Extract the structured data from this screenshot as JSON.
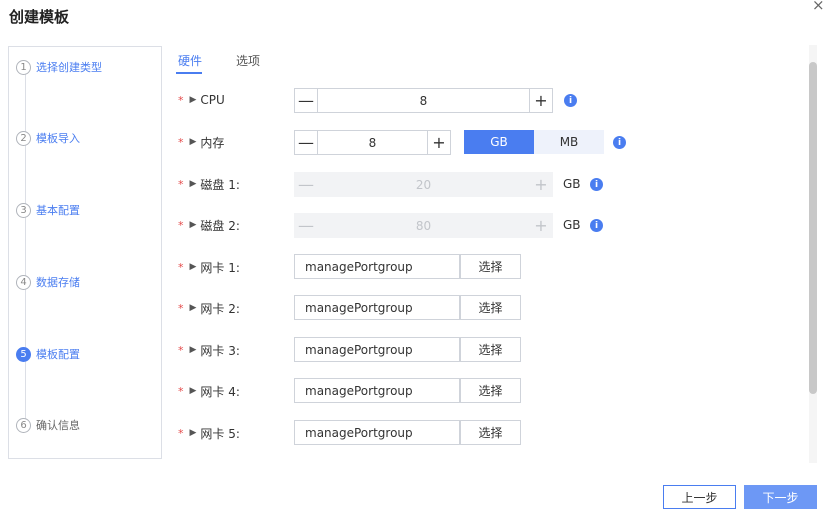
{
  "dialog": {
    "title": "创建模板",
    "close_glyph": "×"
  },
  "steps": [
    {
      "num": "1",
      "label": "选择创建类型"
    },
    {
      "num": "2",
      "label": "模板导入"
    },
    {
      "num": "3",
      "label": "基本配置"
    },
    {
      "num": "4",
      "label": "数据存储"
    },
    {
      "num": "5",
      "label": "模板配置"
    },
    {
      "num": "6",
      "label": "确认信息"
    }
  ],
  "tabs": [
    {
      "label": "硬件"
    },
    {
      "label": "选项"
    }
  ],
  "hardware": {
    "cpu": {
      "label": "CPU",
      "value": "8"
    },
    "memory": {
      "label": "内存",
      "value": "8",
      "units": [
        "GB",
        "MB"
      ],
      "selected_unit": "GB"
    },
    "disk1": {
      "label": "磁盘 1:",
      "value": "20",
      "unit": "GB"
    },
    "disk2": {
      "label": "磁盘 2:",
      "value": "80",
      "unit": "GB"
    },
    "nics": [
      {
        "label": "网卡 1:",
        "value": "managePortgroup",
        "button": "选择"
      },
      {
        "label": "网卡 2:",
        "value": "managePortgroup",
        "button": "选择"
      },
      {
        "label": "网卡 3:",
        "value": "managePortgroup",
        "button": "选择"
      },
      {
        "label": "网卡 4:",
        "value": "managePortgroup",
        "button": "选择"
      },
      {
        "label": "网卡 5:",
        "value": "managePortgroup",
        "button": "选择"
      }
    ]
  },
  "symbols": {
    "required": "*",
    "expand": "▶",
    "minus": "—",
    "plus": "+",
    "info": "i"
  },
  "footer": {
    "prev": "上一步",
    "next": "下一步"
  },
  "colors": {
    "accent": "#4a7df0",
    "required": "#e44a4a"
  }
}
